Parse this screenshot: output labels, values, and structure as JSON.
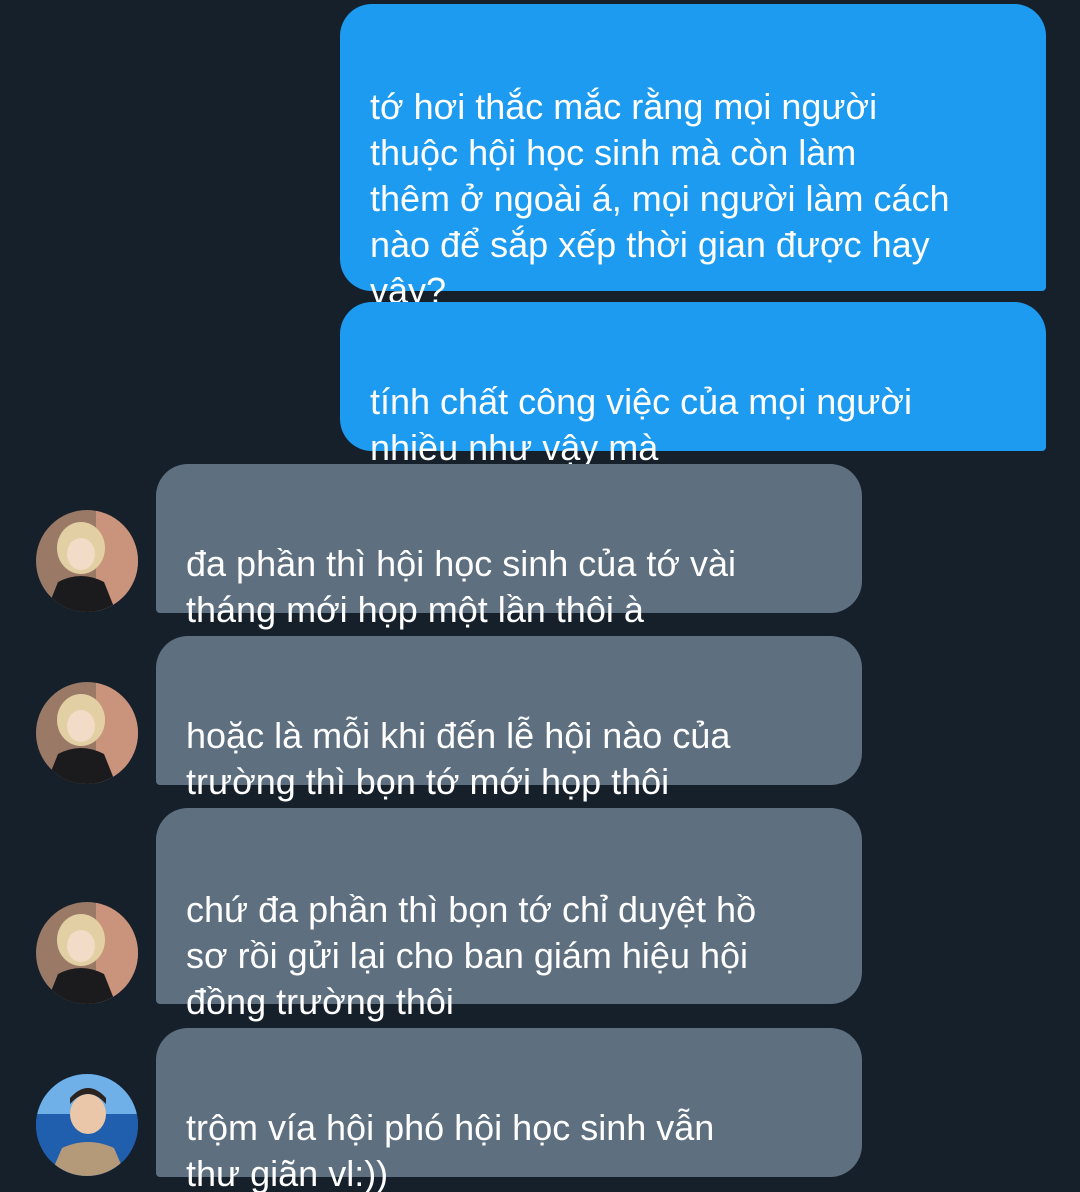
{
  "conversation": {
    "messages": [
      {
        "direction": "outgoing",
        "text": "tớ hơi thắc mắc rằng mọi người\nthuộc hội học sinh mà còn làm\nthêm ở ngoài á, mọi người làm cách\nnào để sắp xếp thời gian được hay\nvậy?"
      },
      {
        "direction": "outgoing",
        "text": "tính chất công việc của mọi người\nnhiều như vậy mà"
      },
      {
        "direction": "incoming",
        "avatar": "blond-person-avatar",
        "text": "đa phần thì hội học sinh của tớ vài\ntháng mới họp một lần thôi à"
      },
      {
        "direction": "incoming",
        "avatar": "blond-person-avatar",
        "text": "hoặc là mỗi khi đến lễ hội nào của\ntrường thì bọn tớ mới họp thôi"
      },
      {
        "direction": "incoming",
        "avatar": "blond-person-avatar",
        "text": "chứ đa phần thì bọn tớ chỉ duyệt hồ\nsơ rồi gửi lại cho ban giám hiệu hội\nđồng trường thôi"
      },
      {
        "direction": "incoming",
        "avatar": "ocean-person-avatar",
        "text": "trộm vía hội phó hội học sinh vẫn\nthư giãn vl:))"
      }
    ]
  },
  "colors": {
    "background": "#16202b",
    "outgoing_bubble": "#1d9bf0",
    "incoming_bubble": "#5e6f80",
    "text": "#ffffff"
  }
}
